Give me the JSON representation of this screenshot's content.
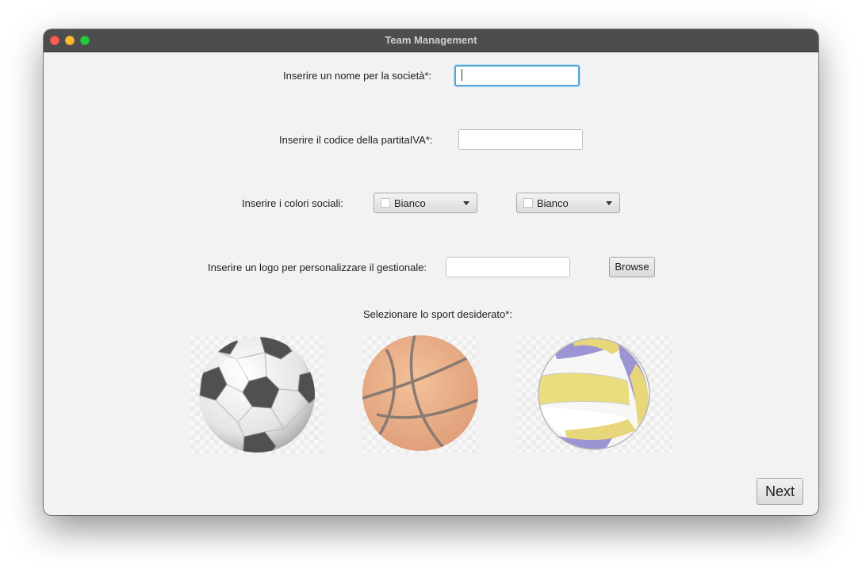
{
  "window": {
    "title": "Team Management"
  },
  "form": {
    "name_label": "Inserire un nome per la società*:",
    "name_value": "",
    "vat_label": "Inserire il codice della partitaIVA*:",
    "vat_value": "",
    "colors_label": "Inserire i colori sociali:",
    "color1": {
      "value": "Bianco",
      "swatch": "#ffffff"
    },
    "color2": {
      "value": "Bianco",
      "swatch": "#ffffff"
    },
    "logo_label": "Inserire un logo per personalizzare il gestionale:",
    "logo_value": "",
    "browse_label": "Browse",
    "sport_label": "Selezionare lo sport desiderato*:",
    "sports": [
      {
        "icon": "soccer-ball-icon"
      },
      {
        "icon": "basketball-icon"
      },
      {
        "icon": "volleyball-icon"
      }
    ]
  },
  "footer": {
    "next_label": "Next"
  },
  "colors": {
    "titlebar": "#4d4d4f",
    "window_bg": "#f2f2f2",
    "focus_ring": "#57a5dc"
  }
}
